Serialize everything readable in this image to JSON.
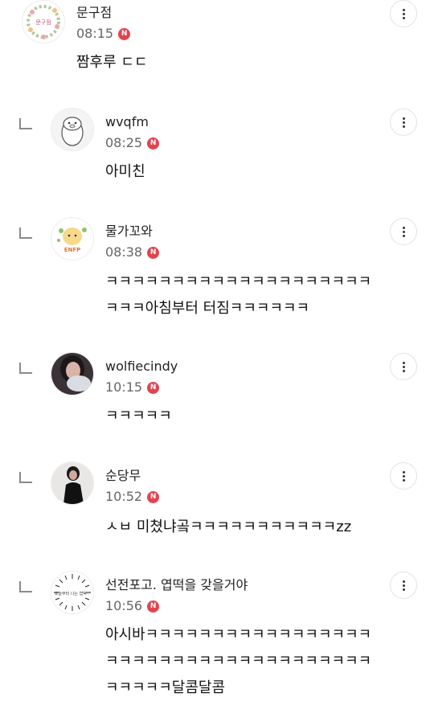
{
  "comments": [
    {
      "author": "문구점",
      "time": "08:15",
      "badge": "N",
      "text": "짬후루 ㄷㄷ",
      "avatar": "wreath-avatar",
      "avatar_text": "문구점"
    },
    {
      "author": "wvqfm",
      "time": "08:25",
      "badge": "N",
      "text": "아미친",
      "avatar": "cartoon-character-avatar"
    },
    {
      "author": "물가꼬와",
      "time": "08:38",
      "badge": "N",
      "text": "ㅋㅋㅋㅋㅋㅋㅋㅋㅋㅋㅋㅋㅋㅋㅋㅋㅋㅋㅋㅋㅋㅋㅋ아침부터 터짐ㅋㅋㅋㅋㅋㅋ",
      "avatar": "bear-sticker-avatar",
      "avatar_text": "ENFP"
    },
    {
      "author": "wolfiecindy",
      "time": "10:15",
      "badge": "N",
      "text": "ㅋㅋㅋㅋㅋ",
      "avatar": "photo-avatar"
    },
    {
      "author": "순당무",
      "time": "10:52",
      "badge": "N",
      "text": "ㅅㅂ 미쳤냐곸ㅋㅋㅋㅋㅋㅋㅋㅋㅋㅋㅋzz",
      "avatar": "photo-avatar"
    },
    {
      "author": "선전포고. 엽떡을 갖을거야",
      "time": "10:56",
      "badge": "N",
      "text": "아시바ㅋㅋㅋㅋㅋㅋㅋㅋㅋㅋㅋㅋㅋㅋㅋㅋㅋㅋㅋㅋㅋㅋㅋㅋㅋㅋㅋㅋㅋㅋㅋㅋㅋㅋㅋㅋㅋㅋㅋㅋㅋㅋ달콤달콤",
      "avatar": "sunburst-text-avatar",
      "avatar_text": "오늘부터 나는 엽떡♡"
    }
  ],
  "icons": {
    "more": "more-vertical-icon",
    "reply": "reply-arrow-icon",
    "badge": "new-badge"
  },
  "colors": {
    "badge": "#e2434f",
    "time": "#666666",
    "text": "#111111"
  }
}
